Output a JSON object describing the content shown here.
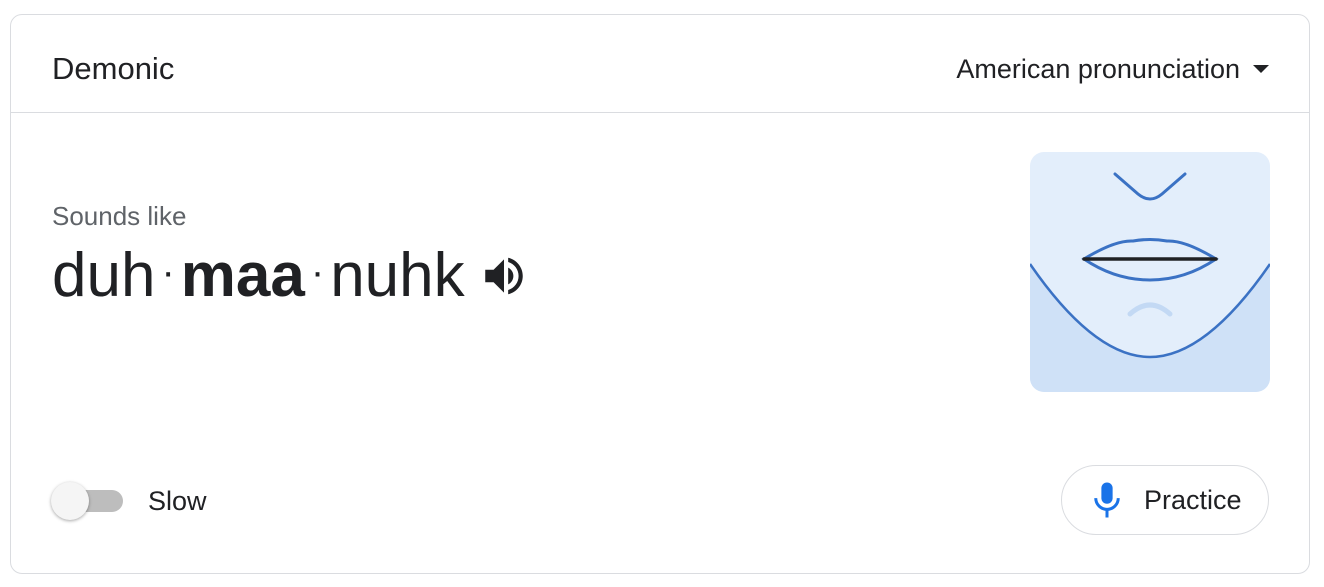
{
  "header": {
    "word": "Demonic",
    "accent": "American pronunciation"
  },
  "pronunciation": {
    "sounds_like_label": "Sounds like",
    "syllables": [
      {
        "text": "duh",
        "stressed": false
      },
      {
        "text": "maa",
        "stressed": true
      },
      {
        "text": "nuhk",
        "stressed": false
      }
    ],
    "separator": "·"
  },
  "controls": {
    "slow_label": "Slow",
    "slow_enabled": false,
    "practice_label": "Practice"
  },
  "icons": {
    "speaker": "speaker-icon",
    "mic": "mic-icon",
    "dropdown": "chevron-down-icon"
  },
  "colors": {
    "accent_blue": "#1a73e8",
    "illustration_bg": "#e3eefb",
    "illustration_chin": "#cfe1f7",
    "illustration_line": "#3b72c4"
  }
}
